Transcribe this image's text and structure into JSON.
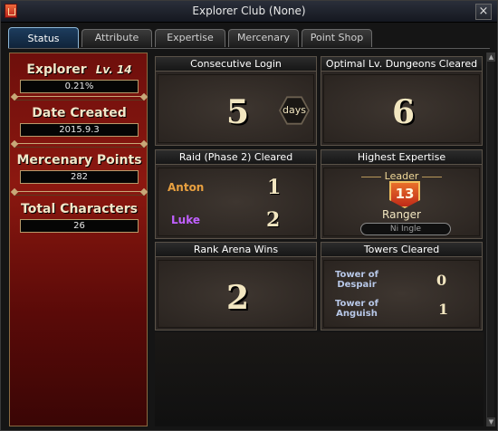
{
  "window": {
    "title": "Explorer Club (None)",
    "close_label": "×"
  },
  "tabs": [
    {
      "label": "Status",
      "active": true
    },
    {
      "label": "Attribute",
      "active": false
    },
    {
      "label": "Expertise",
      "active": false
    },
    {
      "label": "Mercenary",
      "active": false
    },
    {
      "label": "Point Shop",
      "active": false
    }
  ],
  "left": {
    "explorer": {
      "label": "Explorer",
      "level": "Lv. 14",
      "value": "0.21%"
    },
    "date_created": {
      "label": "Date Created",
      "value": "2015.9.3"
    },
    "mercenary_points": {
      "label": "Mercenary Points",
      "value": "282"
    },
    "total_characters": {
      "label": "Total Characters",
      "value": "26"
    }
  },
  "cards": {
    "consecutive_login": {
      "title": "Consecutive Login",
      "value": "5",
      "unit": "days"
    },
    "optimal_dungeons": {
      "title": "Optimal Lv. Dungeons Cleared",
      "value": "6"
    },
    "raid": {
      "title": "Raid (Phase 2) Cleared",
      "rows": [
        {
          "name": "Anton",
          "value": "1",
          "color": "#e8a040"
        },
        {
          "name": "Luke",
          "value": "2",
          "color": "#c060ff"
        }
      ]
    },
    "highest_expertise": {
      "title": "Highest Expertise",
      "rank": "Leader",
      "level": "13",
      "class": "Ranger",
      "character": "Ni Ingle"
    },
    "rank_arena": {
      "title": "Rank Arena Wins",
      "value": "2"
    },
    "towers": {
      "title": "Towers Cleared",
      "rows": [
        {
          "name": "Tower of Despair",
          "value": "0"
        },
        {
          "name": "Tower of Anguish",
          "value": "1"
        }
      ]
    }
  }
}
